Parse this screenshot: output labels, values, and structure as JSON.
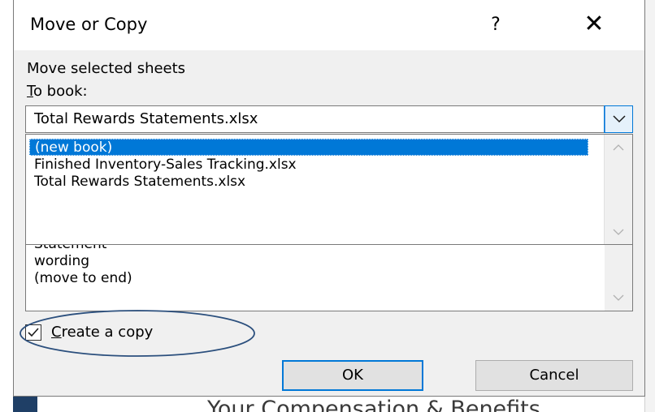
{
  "dialog": {
    "title": "Move or Copy",
    "help_label": "?",
    "close_label": "✕",
    "move_label": "Move selected sheets",
    "to_book_label_underlined": "T",
    "to_book_label_rest": "o book:",
    "to_book_value": "Total Rewards Statements.xlsx",
    "to_book_options": [
      "(new book)",
      "Finished Inventory-Sales Tracking.xlsx",
      "Total Rewards Statements.xlsx"
    ],
    "highlighted_option": "(new book)",
    "before_sheet_items": [
      "Statement",
      "wording",
      "(move to end)"
    ],
    "create_copy_checked": true,
    "create_copy_underlined": "C",
    "create_copy_rest": "reate a copy",
    "ok_label": "OK",
    "cancel_label": "Cancel"
  },
  "background": {
    "sheet_text": "Your Compensation & Benefits"
  },
  "colors": {
    "accent": "#0078d7",
    "annotation": "#2b4f7d"
  }
}
